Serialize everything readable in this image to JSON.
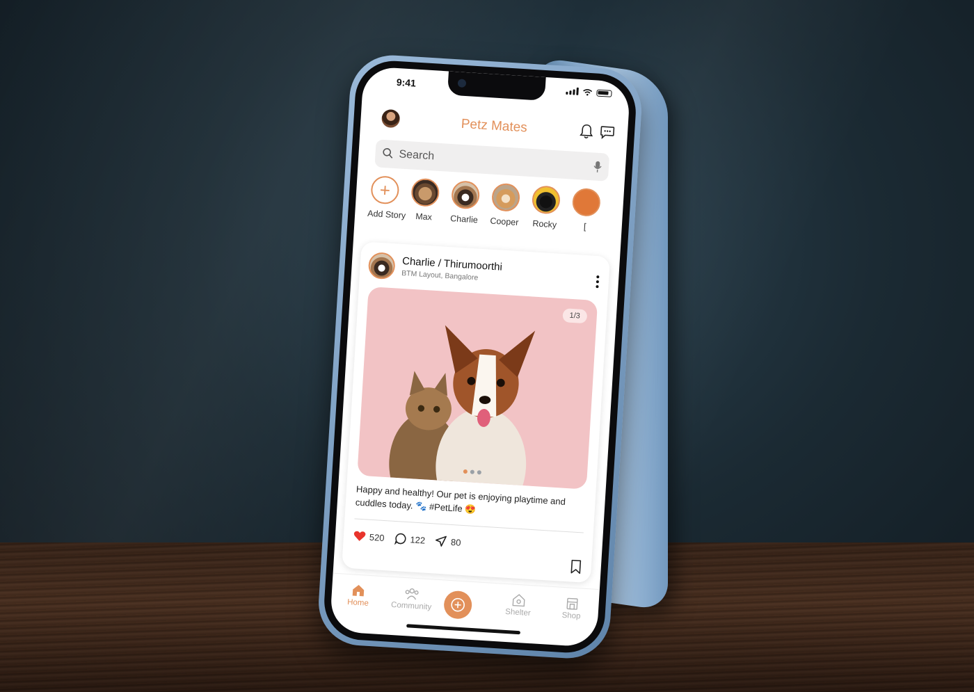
{
  "status": {
    "time": "9:41"
  },
  "app": {
    "title": "Petz Mates",
    "accent": "#e2905a"
  },
  "search": {
    "placeholder": "Search"
  },
  "stories": [
    {
      "label": "Add Story",
      "icon": "plus-icon"
    },
    {
      "label": "Max"
    },
    {
      "label": "Charlie"
    },
    {
      "label": "Cooper"
    },
    {
      "label": "Rocky"
    },
    {
      "label": "["
    }
  ],
  "post": {
    "author": "Charlie / Thirumoorthi",
    "location": "BTM Layout, Bangalore",
    "page_indicator": "1/3",
    "caption": "Happy and healthy! Our pet is enjoying playtime and cuddles today. 🐾 #PetLife 😍",
    "likes": "520",
    "comments": "122",
    "shares": "80"
  },
  "nav": {
    "home": "Home",
    "community": "Community",
    "shelter": "Shelter",
    "shop": "Shop"
  }
}
